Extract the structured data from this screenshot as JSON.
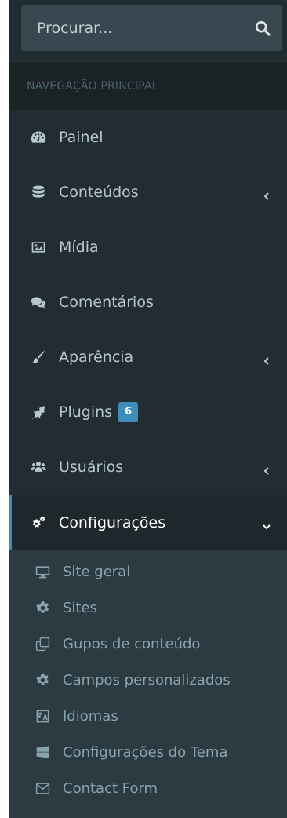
{
  "search": {
    "placeholder": "Procurar..."
  },
  "nav_header": "NAVEGAÇÃO PRINCIPAL",
  "menu": [
    {
      "label": "Painel",
      "icon": "dashboard-icon",
      "expandable": false
    },
    {
      "label": "Conteúdos",
      "icon": "database-icon",
      "expandable": true
    },
    {
      "label": "Mídia",
      "icon": "image-icon",
      "expandable": false
    },
    {
      "label": "Comentários",
      "icon": "comments-icon",
      "expandable": false
    },
    {
      "label": "Aparência",
      "icon": "paint-brush-icon",
      "expandable": true
    },
    {
      "label": "Plugins",
      "icon": "plug-icon",
      "badge": "6",
      "expandable": false
    },
    {
      "label": "Usuários",
      "icon": "users-icon",
      "expandable": true
    },
    {
      "label": "Configurações",
      "icon": "cogs-icon",
      "expandable": true,
      "active": true
    }
  ],
  "submenu": [
    {
      "label": "Site geral",
      "icon": "desktop-icon"
    },
    {
      "label": "Sites",
      "icon": "cog-icon"
    },
    {
      "label": "Gupos de conteúdo",
      "icon": "clone-icon"
    },
    {
      "label": "Campos personalizados",
      "icon": "cog-icon"
    },
    {
      "label": "Idiomas",
      "icon": "language-icon"
    },
    {
      "label": "Configurações do Tema",
      "icon": "windows-icon"
    },
    {
      "label": "Contact Form",
      "icon": "envelope-icon"
    }
  ],
  "colors": {
    "sidebar_bg": "#222d32",
    "header_bg": "#1a2226",
    "active_bg": "#1e282c",
    "submenu_bg": "#2c3b41",
    "accent": "#3c8dbc",
    "text": "#b8c7ce"
  }
}
